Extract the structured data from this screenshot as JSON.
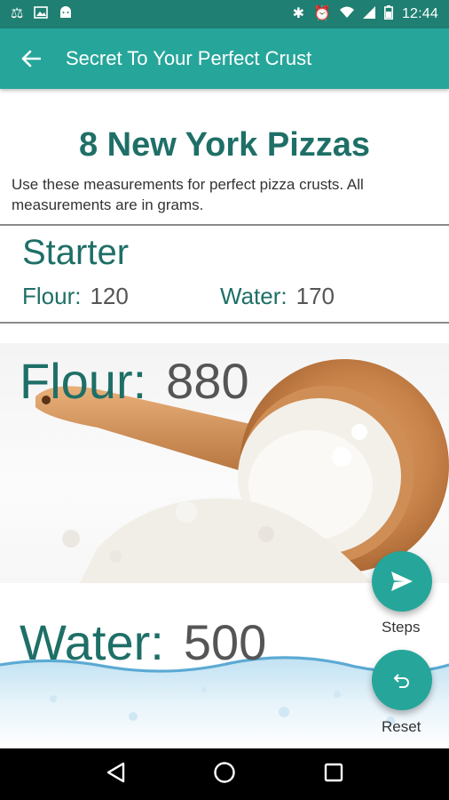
{
  "status_bar": {
    "time": "12:44"
  },
  "app_bar": {
    "title": "Secret To Your Perfect Crust"
  },
  "main": {
    "headline": "8 New York Pizzas",
    "subtitle": "Use these measurements for perfect pizza crusts. All measurements are in grams."
  },
  "starter": {
    "title": "Starter",
    "flour_label": "Flour:",
    "flour_value": "120",
    "water_label": "Water:",
    "water_value": "170"
  },
  "flour": {
    "label": "Flour:",
    "value": "880"
  },
  "water": {
    "label": "Water:",
    "value": "500"
  },
  "fabs": {
    "steps_label": "Steps",
    "reset_label": "Reset"
  },
  "colors": {
    "primary": "#26a69a",
    "primary_dark": "#1f7f72",
    "accent_text": "#1e6f67"
  }
}
